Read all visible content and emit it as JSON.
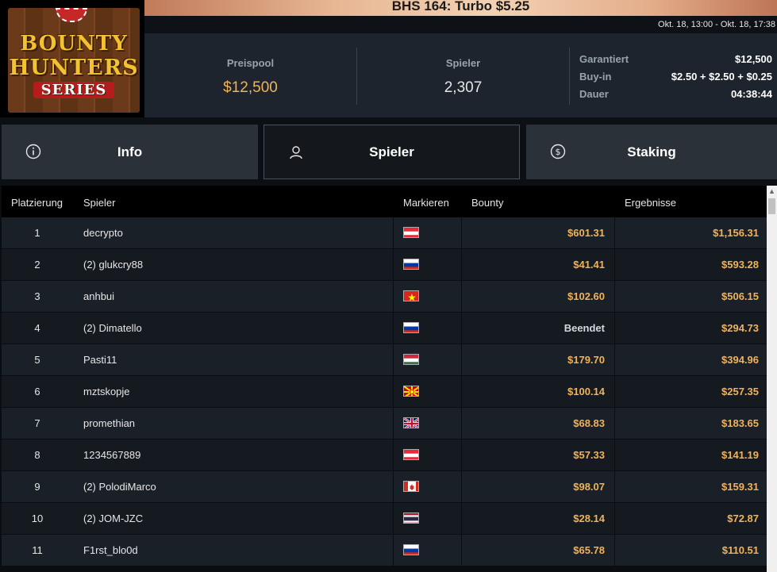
{
  "logo": {
    "line1": "BOUNTY",
    "line2": "HUNTERS",
    "line3": "SERIES"
  },
  "title": "BHS 164: Turbo $5.25",
  "date_range": "Okt. 18, 13:00 - Okt. 18, 17:38",
  "stats": {
    "prizepool_label": "Preispool",
    "prizepool_value": "$12,500",
    "players_label": "Spieler",
    "players_value": "2,307"
  },
  "details": [
    {
      "key": "Garantiert",
      "value": "$12,500"
    },
    {
      "key": "Buy-in",
      "value": "$2.50 + $2.50 + $0.25"
    },
    {
      "key": "Dauer",
      "value": "04:38:44"
    }
  ],
  "tabs": [
    {
      "label": "Info",
      "icon": "info-icon",
      "active": false
    },
    {
      "label": "Spieler",
      "icon": "user-icon",
      "active": true
    },
    {
      "label": "Staking",
      "icon": "dollar-coin-icon",
      "active": false
    }
  ],
  "table": {
    "headers": {
      "rank": "Platzierung",
      "player": "Spieler",
      "flag": "Markieren",
      "bounty": "Bounty",
      "result": "Ergebnisse"
    },
    "rows": [
      {
        "rank": "1",
        "player": "decrypto",
        "flag": "austria",
        "bounty": "$601.31",
        "result": "$1,156.31"
      },
      {
        "rank": "2",
        "player": "(2) glukcry88",
        "flag": "russia",
        "bounty": "$41.41",
        "result": "$593.28"
      },
      {
        "rank": "3",
        "player": "anhbui",
        "flag": "vietnam",
        "bounty": "$102.60",
        "result": "$506.15"
      },
      {
        "rank": "4",
        "player": "(2) Dimatello",
        "flag": "russia",
        "bounty": "Beendet",
        "result": "$294.73"
      },
      {
        "rank": "5",
        "player": "Pasti11",
        "flag": "hungary",
        "bounty": "$179.70",
        "result": "$394.96"
      },
      {
        "rank": "6",
        "player": "mztskopje",
        "flag": "north-macedonia",
        "bounty": "$100.14",
        "result": "$257.35"
      },
      {
        "rank": "7",
        "player": "promethian",
        "flag": "united-kingdom",
        "bounty": "$68.83",
        "result": "$183.65"
      },
      {
        "rank": "8",
        "player": "1234567889",
        "flag": "austria",
        "bounty": "$57.33",
        "result": "$141.19"
      },
      {
        "rank": "9",
        "player": "(2) PolodiMarco",
        "flag": "canada",
        "bounty": "$98.07",
        "result": "$159.31"
      },
      {
        "rank": "10",
        "player": "(2) JOM-JZC",
        "flag": "thailand",
        "bounty": "$28.14",
        "result": "$72.87"
      },
      {
        "rank": "11",
        "player": "F1rst_blo0d",
        "flag": "russia",
        "bounty": "$65.78",
        "result": "$110.51"
      }
    ]
  },
  "colors": {
    "accent_gold": "#f0b35a",
    "panel": "#1d242d",
    "tab": "#2b3138"
  }
}
